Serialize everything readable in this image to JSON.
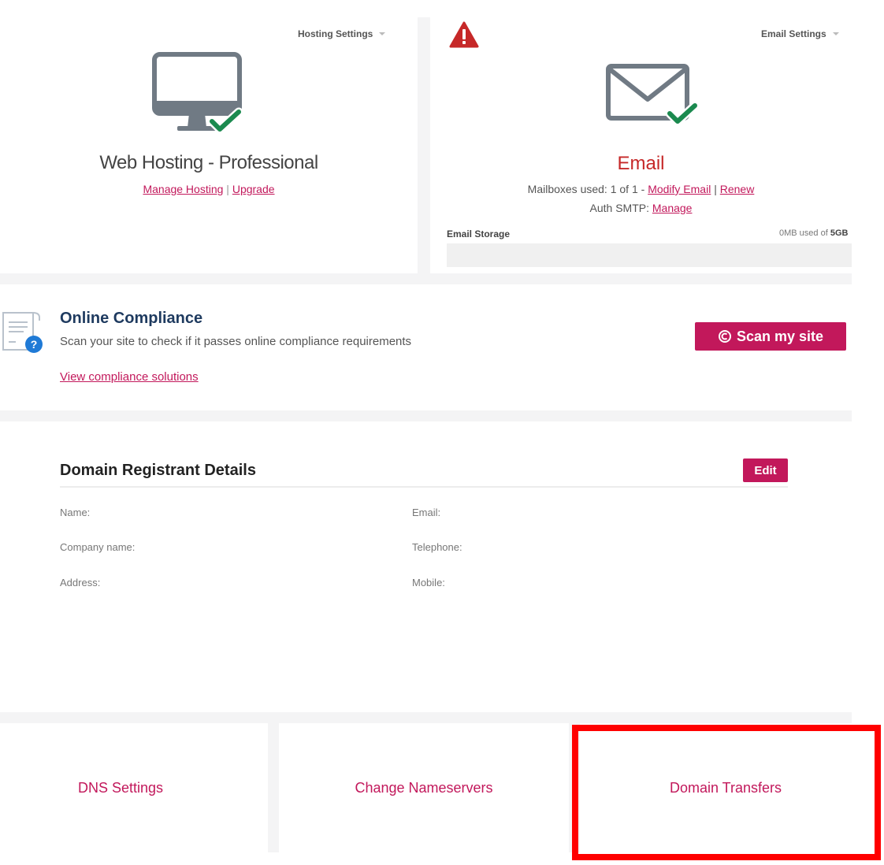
{
  "hosting": {
    "settings_label": "Hosting Settings",
    "title": "Web Hosting - Professional",
    "manage_link": "Manage Hosting",
    "separator": "|",
    "upgrade_link": "Upgrade",
    "icon": "monitor-check-icon"
  },
  "email": {
    "settings_label": "Email Settings",
    "title": "Email",
    "mailboxes_text": "Mailboxes used: 1 of 1 - ",
    "modify_link": "Modify Email",
    "separator": "|",
    "renew_link": "Renew",
    "smtp_text": "Auth SMTP: ",
    "smtp_link": "Manage",
    "storage_label": "Email Storage",
    "storage_used_prefix": "0MB used of ",
    "storage_total": "5GB",
    "storage_fraction": 0,
    "icon": "envelope-check-icon",
    "warning_icon": "warning-triangle-icon"
  },
  "compliance": {
    "title": "Online Compliance",
    "description": "Scan your site to check if it passes online compliance requirements",
    "link": "View compliance solutions",
    "scan_button": "Scan my site",
    "icon": "document-question-icon"
  },
  "registrant": {
    "title": "Domain Registrant Details",
    "edit_button": "Edit",
    "fields_left": [
      "Name:",
      "Company name:",
      "Address:"
    ],
    "fields_right": [
      "Email:",
      "Telephone:",
      "Mobile:"
    ]
  },
  "tiles": [
    "DNS Settings",
    "Change Nameservers",
    "Domain Transfers"
  ],
  "colors": {
    "accent": "#c2185b",
    "heading_blue": "#1e3a5f",
    "email_red": "#c62828",
    "check_green": "#1b8a4f",
    "highlight_red": "#ff0000"
  }
}
